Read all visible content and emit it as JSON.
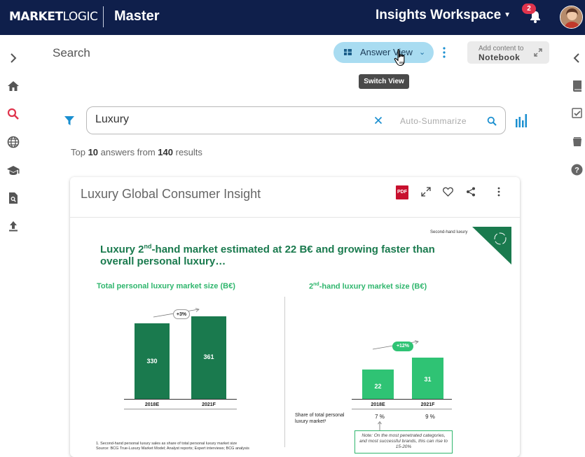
{
  "topbar": {
    "logo_bold": "MARKET",
    "logo_light": "LOGIC",
    "app_name": "Master",
    "workspace": "Insights Workspace",
    "notification_count": "2"
  },
  "left_rail": {
    "icons": [
      "chevron-right-icon",
      "home-icon",
      "search-icon",
      "globe-icon",
      "graduation-cap-icon",
      "document-search-icon",
      "upload-icon"
    ]
  },
  "right_rail": {
    "icons": [
      "chevron-left-icon",
      "book-icon",
      "checklist-icon",
      "folder-stack-icon",
      "help-icon"
    ]
  },
  "header": {
    "title": "Search",
    "view_button": "Answer View",
    "tooltip": "Switch View",
    "notebook_small": "Add content to",
    "notebook_big": "Notebook"
  },
  "search": {
    "value": "Luxury",
    "auto_summarize": "Auto-Summarize"
  },
  "results": {
    "prefix": "Top ",
    "top_count": "10",
    "middle": " answers from ",
    "total": "140",
    "suffix": " results"
  },
  "card": {
    "title": "Luxury Global Consumer Insight",
    "pdf_label": "PDF"
  },
  "slide": {
    "tag": "Second-hand luxury",
    "headline_part1": "Luxury 2",
    "headline_sup": "nd",
    "headline_part2": "-hand market estimated at 22 B€ and growing faster than overall personal luxury…",
    "left_title": "Total personal luxury market size (B€)",
    "right_title_pre": "2",
    "right_title_sup": "nd",
    "right_title_post": "-hand luxury market size (B€)",
    "share_label": "Share of total personal luxury market¹",
    "note": "Note: On the most penetrated categories, and most successful brands, this can rise to 15-20%",
    "footnote1": "1. Second-hand personal luxury sales as share of total personal luxury market size",
    "footnote2": "Source: BCG True-Luxury Market Model; Analyst reports; Expert interviews; BCG analysis"
  },
  "chart_data": [
    {
      "type": "bar",
      "title": "Total personal luxury market size (B€)",
      "categories": [
        "2018E",
        "2021F"
      ],
      "values": [
        330,
        361
      ],
      "growth_label": "+3%",
      "color": "#1a7a4e"
    },
    {
      "type": "bar",
      "title": "2nd-hand luxury market size (B€)",
      "categories": [
        "2018E",
        "2021F"
      ],
      "values": [
        22,
        31
      ],
      "growth_label": "+12%",
      "share_of_total": [
        "7 %",
        "9 %"
      ],
      "color": "#2fc374"
    }
  ],
  "colors": {
    "topbar": "#0f1f4b",
    "accent_blue": "#1aa0d8",
    "view_button_bg": "#a9dcf1",
    "dark_green": "#1a7a4e",
    "light_green": "#2fc374"
  }
}
